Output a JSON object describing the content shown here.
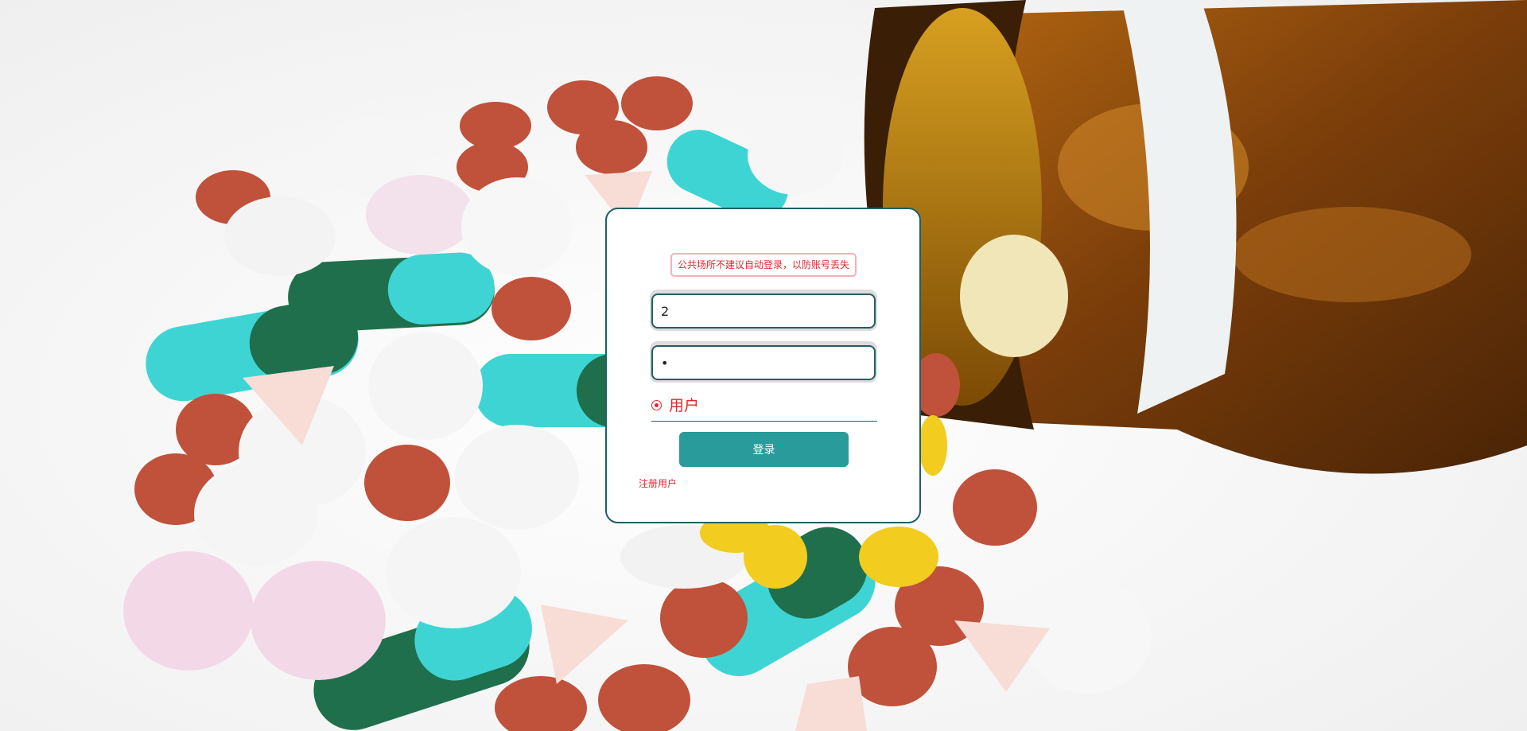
{
  "login": {
    "notice": "公共场所不建议自动登录，以防账号丢失",
    "username_value": "2",
    "password_value": "2",
    "role_option": "用户",
    "submit_label": "登录",
    "register_label": "注册用户"
  },
  "colors": {
    "accent": "#2a9b9b",
    "border": "#1f5f64",
    "warning": "#e2262d"
  },
  "icons": {
    "background": "medicine-pills-bottle-illustration",
    "role_selector": "radio-selected-icon"
  }
}
